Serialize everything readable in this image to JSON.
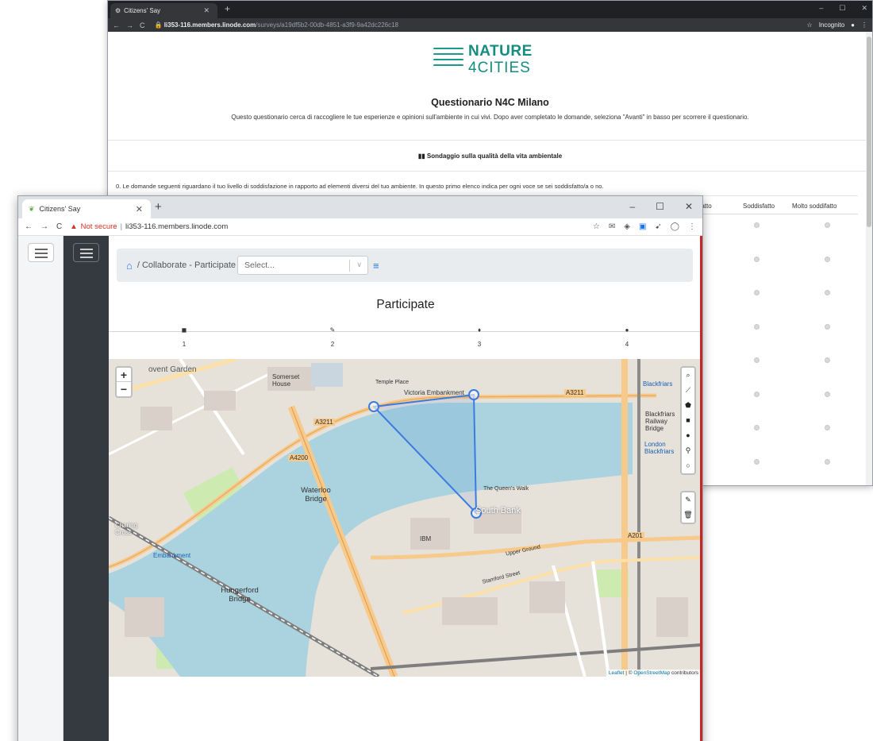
{
  "back_window": {
    "tab_title": "Citizens' Say",
    "url_host": "li353-116.members.linode.com",
    "url_path": "/surveys/a19df5b2-00db-4851-a3f9-9a42dc226c18",
    "incognito_label": "Incognito",
    "logo_line1": "NATURE",
    "logo_line2": "4CITIES",
    "survey_title": "Questionario N4C Milano",
    "survey_description": "Questo questionario cerca di raccogliere le tue esperienze e opinioni sull'ambiente in cui vivi. Dopo aver completato le domande, seleziona \"Avanti\" in basso per scorrere il questionario.",
    "section_title": "Sondaggio sulla qualità della vita ambientale",
    "question_text": "0. Le domande seguenti riguardano il tuo livello di soddisfazione in rapporto ad elementi diversi del tuo ambiente. In questo primo elenco indica per ogni voce se sei soddisfatto/a o no.",
    "column_headers": [
      "oddisfatto",
      "Soddisfatto",
      "Molto soddifatto"
    ],
    "radio_rows": 8
  },
  "front_window": {
    "tab_title": "Citizens' Say",
    "not_secure_label": "Not secure",
    "url_host": "li353-116.members.linode.com",
    "breadcrumb_current": "Collaborate - Participate",
    "select_placeholder": "Select...",
    "page_title": "Participate",
    "steps": [
      {
        "number": "1",
        "icon": "square-icon"
      },
      {
        "number": "2",
        "icon": "pencil-icon"
      },
      {
        "number": "3",
        "icon": "pin-icon"
      },
      {
        "number": "4",
        "icon": "comments-icon"
      }
    ],
    "map": {
      "zoom_in": "+",
      "zoom_out": "−",
      "attribution_leaflet": "Leaflet",
      "attribution_sep": " | © ",
      "attribution_osm": "OpenStreetMap",
      "attribution_tail": " contributors",
      "labels": {
        "covent_garden": "ovent Garden",
        "somerset_house": "Somerset House",
        "victoria_embankment": "Victoria Embankment",
        "a3211": "A3211",
        "a4200": "A4200",
        "waterloo_bridge": "Waterloo Bridge",
        "south_bank": "South Bank",
        "blackfriars": "Blackfriars",
        "blackfriars_railway_bridge": "Blackfriars Railway Bridge",
        "embankment": "Embankment",
        "charing_cross": "Charing Cross",
        "hungerford_bridge": "Hungerford Bridge",
        "a201": "A201",
        "ibm": "IBM",
        "queens_walk": "The Queen's Walk",
        "stamford_street": "Stamford Street",
        "temple_place": "Temple Place",
        "victoria_embankment_east": "Victoria Embankment",
        "upper_ground": "Upper Ground",
        "london_blackfriars": "London Blackfriars"
      }
    },
    "map_tools": [
      "search-icon",
      "polyline-icon",
      "polygon-icon",
      "rectangle-icon",
      "circle-marker-icon",
      "marker-icon",
      "circle-icon"
    ],
    "map_edit_tools": [
      "edit-icon",
      "trash-icon"
    ]
  },
  "colors": {
    "brand_teal": "#138d80",
    "accent_blue": "#2a7ae2",
    "drawn_shape": "#3b7be0",
    "dark_sidebar": "#343a40",
    "river": "#aad3df"
  }
}
